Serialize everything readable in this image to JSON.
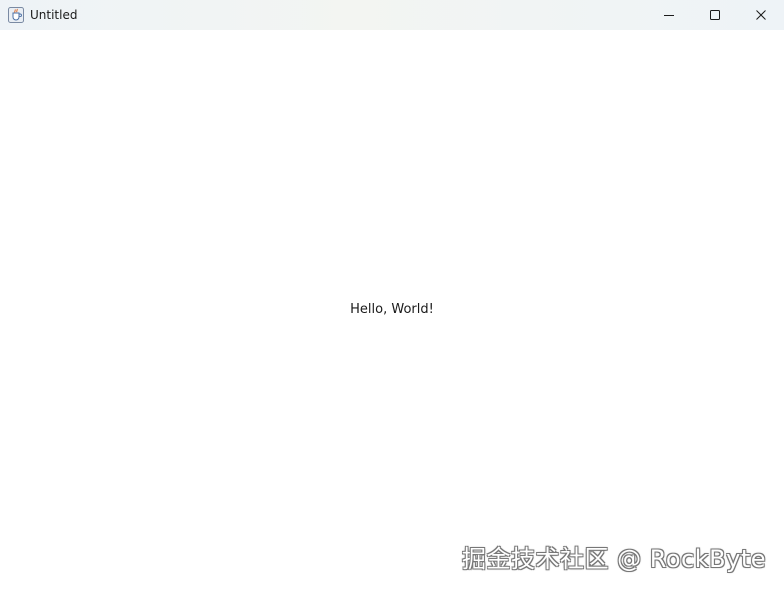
{
  "window": {
    "title": "Untitled",
    "app_icon": "java-coffee-icon",
    "controls": {
      "minimize_icon": "minimize-icon",
      "maximize_icon": "maximize-icon",
      "close_icon": "close-icon"
    }
  },
  "content": {
    "label": "Hello, World!"
  },
  "watermark": {
    "text": "掘金技术社区 @ RockByte"
  },
  "colors": {
    "titlebar": "#eef3f7",
    "background": "#ffffff",
    "text": "#1a1a1a"
  }
}
